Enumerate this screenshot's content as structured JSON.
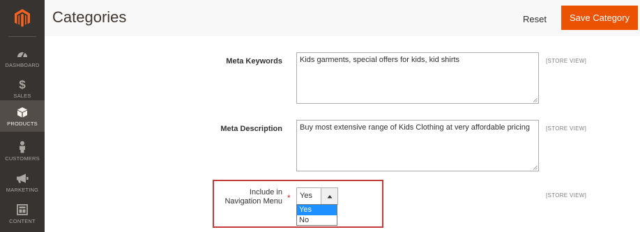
{
  "sidebar": {
    "logo_icon": "magento-logo-icon",
    "items": [
      {
        "label": "DASHBOARD",
        "icon": "speedometer-icon"
      },
      {
        "label": "SALES",
        "icon": "dollar-icon"
      },
      {
        "label": "PRODUCTS",
        "icon": "cube-icon",
        "active": true
      },
      {
        "label": "CUSTOMERS",
        "icon": "person-icon"
      },
      {
        "label": "MARKETING",
        "icon": "megaphone-icon"
      },
      {
        "label": "CONTENT",
        "icon": "layout-icon"
      }
    ]
  },
  "header": {
    "title": "Categories",
    "reset_label": "Reset",
    "save_label": "Save Category"
  },
  "form": {
    "meta_keywords": {
      "label": "Meta Keywords",
      "value": "Kids garments, special offers for kids, kid shirts",
      "scope": "[STORE VIEW]"
    },
    "meta_description": {
      "label": "Meta Description",
      "value": "Buy most extensive range of Kids Clothing at very affordable pricing",
      "scope": "[STORE VIEW]"
    },
    "include_in_menu": {
      "label_line1": "Include in",
      "label_line2": "Navigation Menu",
      "required_mark": "*",
      "value": "Yes",
      "options": [
        "Yes",
        "No"
      ],
      "scope": "[STORE VIEW]"
    }
  },
  "colors": {
    "sidebar_bg": "#373330",
    "sidebar_active_bg": "#524d49",
    "accent": "#eb5202",
    "highlight_border": "#c23a3a",
    "option_selected": "#1e90ff"
  }
}
